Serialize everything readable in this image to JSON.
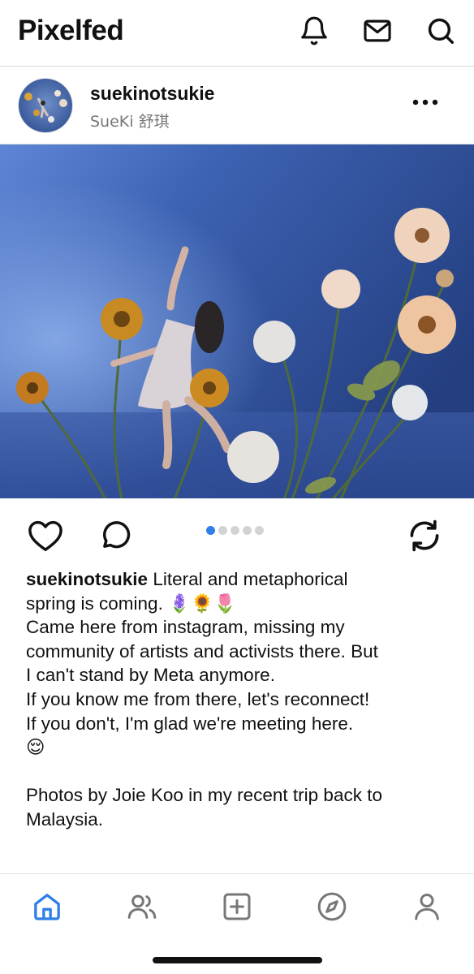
{
  "app": {
    "title": "Pixelfed"
  },
  "header": {
    "icons": [
      "bell-icon",
      "mail-icon",
      "search-icon"
    ]
  },
  "post": {
    "username": "suekinotsukie",
    "display_name": "SueKi 舒琪",
    "photo": {
      "current_index": 1,
      "total": 5
    },
    "caption_user": "suekinotsukie",
    "caption_text": " Literal and metaphorical\nspring is coming. 🪻🌻🌷\nCame here from instagram, missing my\ncommunity of artists and activists there. But\nI can't stand by Meta anymore.\nIf you know me from there, let's reconnect!\nIf you don't, I'm glad we're meeting here.\n😌\n\nPhotos by Joie Koo in my recent trip back to\nMalaysia."
  },
  "actions": {
    "icons": [
      "heart-icon",
      "comment-icon",
      "repost-icon"
    ]
  },
  "bottom_nav": {
    "items": [
      "home-icon",
      "people-icon",
      "add-icon",
      "compass-icon",
      "profile-icon"
    ],
    "active": "home-icon"
  },
  "colors": {
    "accent": "#2f7fe8",
    "text": "#111111",
    "muted": "#777777",
    "divider": "#d9d9d9"
  }
}
